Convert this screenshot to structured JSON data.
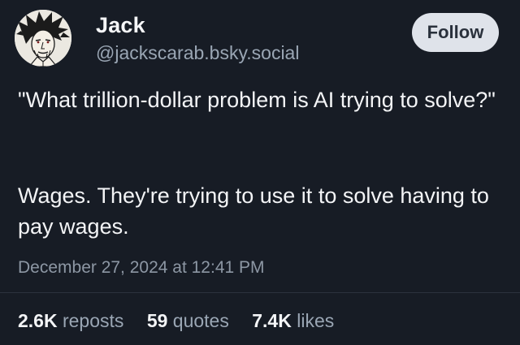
{
  "author": {
    "display_name": "Jack",
    "handle": "@jackscarab.bsky.social"
  },
  "actions": {
    "follow_label": "Follow"
  },
  "post": {
    "paragraph_1": "\"What trillion-dollar problem is AI trying to solve?\"",
    "paragraph_2": "Wages. They're trying to use it to solve having to pay wages.",
    "timestamp": "December 27, 2024 at 12:41 PM"
  },
  "stats": {
    "reposts_count": "2.6K",
    "reposts_label": "reposts",
    "quotes_count": "59",
    "quotes_label": "quotes",
    "likes_count": "7.4K",
    "likes_label": "likes"
  },
  "colors": {
    "background": "#171c25",
    "text_primary": "#f3f4f6",
    "text_secondary": "#9aa6b4",
    "follow_button_bg": "#dfe3ea"
  }
}
